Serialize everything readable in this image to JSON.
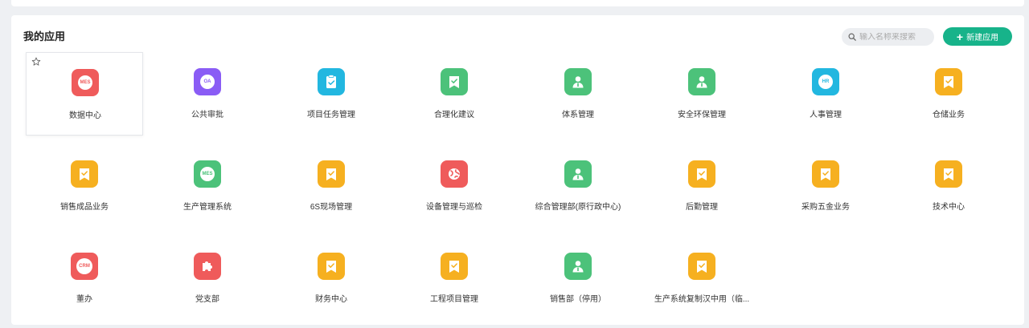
{
  "section_title": "我的应用",
  "search": {
    "placeholder": "输入名称来搜索"
  },
  "new_button": {
    "label": "新建应用"
  },
  "colors": {
    "accent": "#17b38a",
    "red": "#ef5b5b",
    "purple": "#8a5cf5",
    "cyan": "#22b7e0",
    "green": "#4cc27a",
    "orange": "#f6b020"
  },
  "apps": [
    {
      "label": "数据中心",
      "icon": "mes-icon",
      "color": "red",
      "text": "MES"
    },
    {
      "label": "公共审批",
      "icon": "oa-icon",
      "color": "purple",
      "text": "OA"
    },
    {
      "label": "项目任务管理",
      "icon": "clipboard-check-icon",
      "color": "cyan",
      "text": ""
    },
    {
      "label": "合理化建议",
      "icon": "bookmark-check-icon",
      "color": "green",
      "text": ""
    },
    {
      "label": "体系管理",
      "icon": "user-icon",
      "color": "green",
      "text": ""
    },
    {
      "label": "安全环保管理",
      "icon": "user-icon",
      "color": "green",
      "text": ""
    },
    {
      "label": "人事管理",
      "icon": "hr-icon",
      "color": "cyan",
      "text": "HR"
    },
    {
      "label": "仓储业务",
      "icon": "bookmark-check-icon",
      "color": "orange",
      "text": ""
    },
    {
      "label": "销售成品业务",
      "icon": "bookmark-check-icon",
      "color": "orange",
      "text": ""
    },
    {
      "label": "生产管理系统",
      "icon": "mes-icon",
      "color": "green",
      "text": "MES"
    },
    {
      "label": "6S现场管理",
      "icon": "bookmark-check-icon",
      "color": "orange",
      "text": ""
    },
    {
      "label": "设备管理与巡检",
      "icon": "globe-icon",
      "color": "red",
      "text": ""
    },
    {
      "label": "综合管理部(原行政中心)",
      "icon": "user-icon",
      "color": "green",
      "text": ""
    },
    {
      "label": "后勤管理",
      "icon": "bookmark-check-icon",
      "color": "orange",
      "text": ""
    },
    {
      "label": "采购五金业务",
      "icon": "bookmark-check-icon",
      "color": "orange",
      "text": ""
    },
    {
      "label": "技术中心",
      "icon": "bookmark-check-icon",
      "color": "orange",
      "text": ""
    },
    {
      "label": "董办",
      "icon": "crm-icon",
      "color": "red",
      "text": "CRM"
    },
    {
      "label": "党支部",
      "icon": "puzzle-icon",
      "color": "red",
      "text": ""
    },
    {
      "label": "财务中心",
      "icon": "bookmark-check-icon",
      "color": "orange",
      "text": ""
    },
    {
      "label": "工程项目管理",
      "icon": "bookmark-check-icon",
      "color": "orange",
      "text": ""
    },
    {
      "label": "销售部（停用）",
      "icon": "user-icon",
      "color": "green",
      "text": ""
    },
    {
      "label": "生产系统复制汉中用（临...",
      "icon": "bookmark-check-icon",
      "color": "orange",
      "text": ""
    }
  ]
}
